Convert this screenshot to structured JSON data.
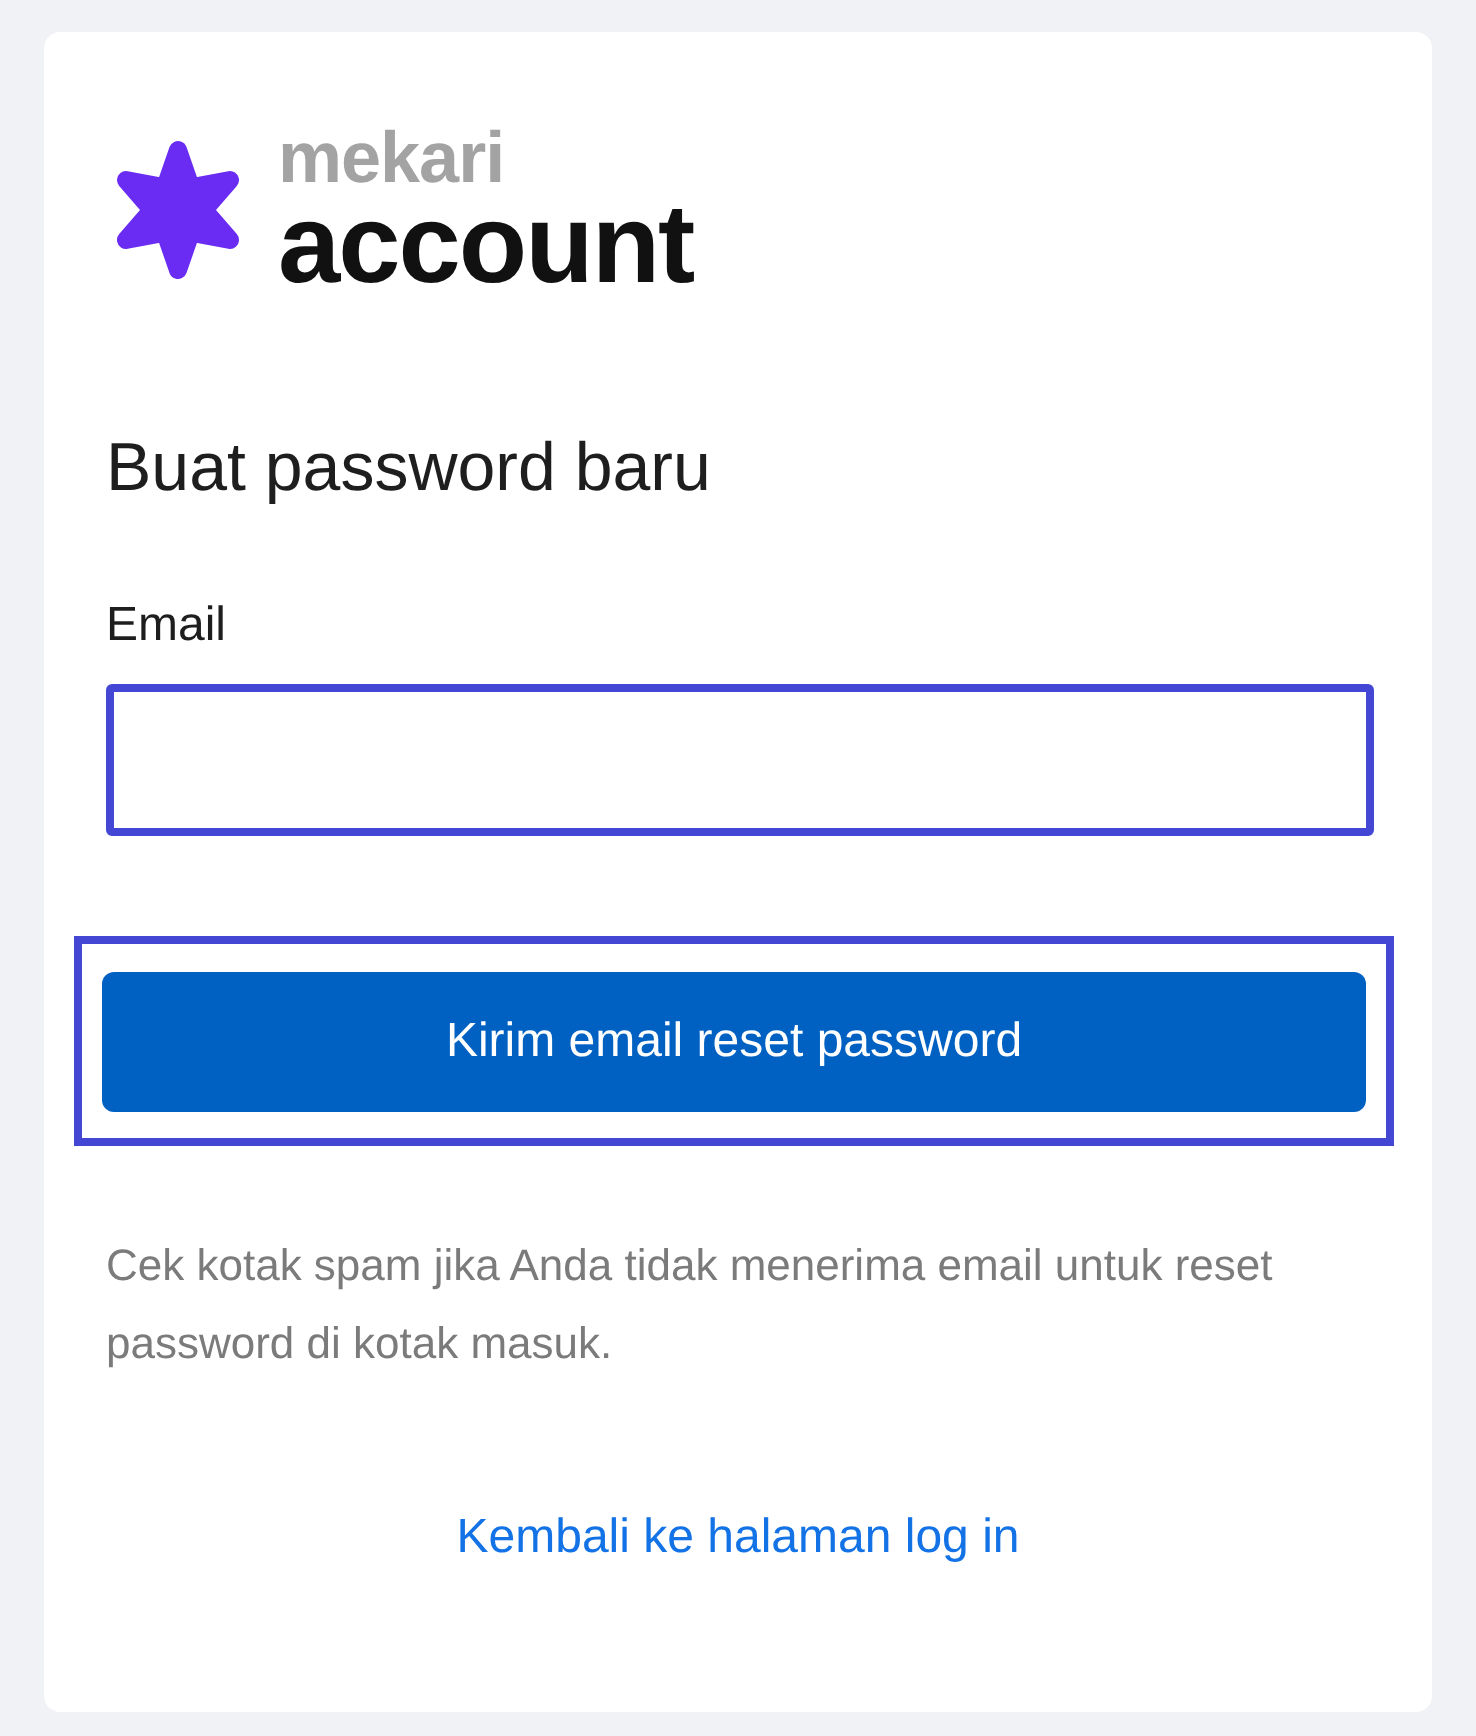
{
  "logo": {
    "brand": "mekari",
    "product": "account"
  },
  "heading": "Buat password baru",
  "email_field": {
    "label": "Email",
    "highlighted": true
  },
  "submit_button": {
    "label": "Kirim email reset password",
    "highlighted": true
  },
  "help_text": "Cek kotak spam jika Anda tidak menerima email untuk reset password di kotak masuk.",
  "back_link": "Kembali ke halaman log in"
}
